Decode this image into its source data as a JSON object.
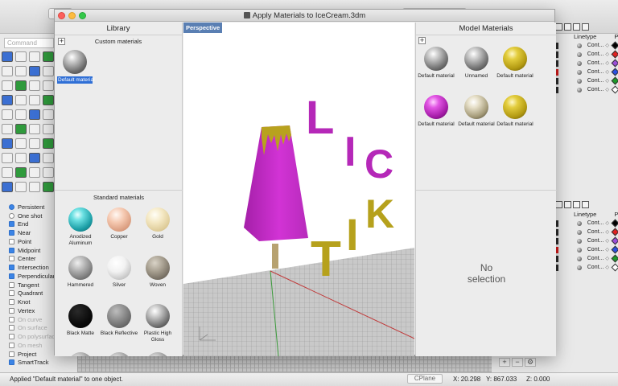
{
  "background": {
    "command_placeholder": "Command",
    "osnaps": [
      {
        "label": "Persistent",
        "kind": "radio",
        "checked": true,
        "dim": false
      },
      {
        "label": "One shot",
        "kind": "radio",
        "checked": false,
        "dim": false
      },
      {
        "label": "End",
        "kind": "check",
        "checked": true,
        "dim": false
      },
      {
        "label": "Near",
        "kind": "check",
        "checked": true,
        "dim": false
      },
      {
        "label": "Point",
        "kind": "check",
        "checked": false,
        "dim": false
      },
      {
        "label": "Midpoint",
        "kind": "check",
        "checked": true,
        "dim": false
      },
      {
        "label": "Center",
        "kind": "check",
        "checked": false,
        "dim": false
      },
      {
        "label": "Intersection",
        "kind": "check",
        "checked": true,
        "dim": false
      },
      {
        "label": "Perpendicular",
        "kind": "check",
        "checked": true,
        "dim": false
      },
      {
        "label": "Tangent",
        "kind": "check",
        "checked": false,
        "dim": false
      },
      {
        "label": "Quadrant",
        "kind": "check",
        "checked": false,
        "dim": false
      },
      {
        "label": "Knot",
        "kind": "check",
        "checked": false,
        "dim": false
      },
      {
        "label": "Vertex",
        "kind": "check",
        "checked": false,
        "dim": false
      },
      {
        "label": "On curve",
        "kind": "check",
        "checked": false,
        "dim": true
      },
      {
        "label": "On surface",
        "kind": "check",
        "checked": false,
        "dim": true
      },
      {
        "label": "On polysurface",
        "kind": "check",
        "checked": false,
        "dim": true
      },
      {
        "label": "On mesh",
        "kind": "check",
        "checked": false,
        "dim": true
      },
      {
        "label": "Project",
        "kind": "check",
        "checked": false,
        "dim": false
      },
      {
        "label": "SmartTrack",
        "kind": "check",
        "checked": true,
        "dim": false
      }
    ],
    "layers": {
      "linetype_header": "Linetype",
      "print_header": "P",
      "rows": [
        {
          "linetype": "Cont...",
          "color": "#000000"
        },
        {
          "linetype": "Cont...",
          "color": "#e02020"
        },
        {
          "linetype": "Cont...",
          "color": "#9b4dd8"
        },
        {
          "linetype": "Cont...",
          "color": "#2b50e0"
        },
        {
          "linetype": "Cont...",
          "color": "#1f9a2a"
        },
        {
          "linetype": "Cont...",
          "color": "#ffffff"
        }
      ]
    },
    "status": {
      "message": "Applied \"Default material\" to one object.",
      "cplane": "CPlane",
      "x": "X: 20.298",
      "y": "Y: 867.033",
      "z": "Z: 0.000"
    }
  },
  "dialog": {
    "title": "Apply Materials to IceCream.3dm",
    "library": {
      "header": "Library",
      "custom_label": "Custom materials",
      "add_symbol": "+",
      "custom_materials": [
        {
          "name": "Default material",
          "selected": true
        }
      ],
      "standard_label": "Standard materials",
      "standard_materials": [
        {
          "name": "Anodized Aluminum",
          "style": "anodized"
        },
        {
          "name": "Copper",
          "style": "copper"
        },
        {
          "name": "Gold",
          "style": "gold"
        },
        {
          "name": "Hammered",
          "style": "hammered"
        },
        {
          "name": "Silver",
          "style": "silver"
        },
        {
          "name": "Woven",
          "style": "woven"
        },
        {
          "name": "Black Matte",
          "style": "blackmatte"
        },
        {
          "name": "Black Reflective",
          "style": "blackreflective"
        },
        {
          "name": "Plastic High Gloss",
          "style": "plasticgloss"
        }
      ]
    },
    "viewport": {
      "label": "Perspective",
      "letters_top": [
        "L",
        "I",
        "C"
      ],
      "letters_bottom": [
        "T",
        "I",
        "K"
      ]
    },
    "model": {
      "header": "Model Materials",
      "add_symbol": "+",
      "materials": [
        {
          "name": "Default material",
          "style": "grey"
        },
        {
          "name": "Unnamed",
          "style": "grey"
        },
        {
          "name": "Default material",
          "style": "yellow"
        },
        {
          "name": "Default material",
          "style": "magenta"
        },
        {
          "name": "Default material",
          "style": "beige"
        },
        {
          "name": "Default material",
          "style": "yellow"
        }
      ],
      "no_selection": "No selection"
    }
  },
  "colors": {
    "accent": "#2f6fd6",
    "popsicle_magenta": "#c62cc9",
    "letter_magenta": "#b528b8",
    "letter_yellow": "#b6a11c",
    "drip_yellow": "#b8a21e"
  }
}
